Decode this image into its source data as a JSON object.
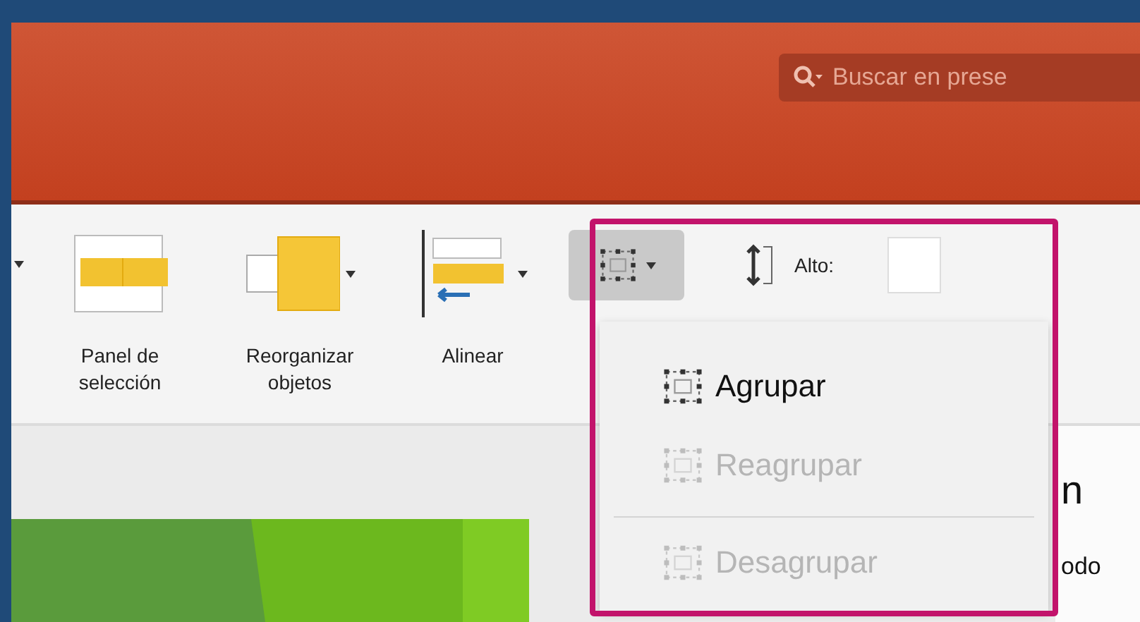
{
  "search": {
    "placeholder": "Buscar en prese"
  },
  "ribbon": {
    "items": [
      {
        "kind": "selection-pane",
        "lines": [
          "Panel de",
          "selección"
        ],
        "dropdown": false
      },
      {
        "kind": "arrange",
        "lines": [
          "Reorganizar",
          "objetos"
        ],
        "dropdown": true
      },
      {
        "kind": "align",
        "lines": [
          "Alinear"
        ],
        "dropdown": true
      }
    ],
    "group_button": {
      "pressed": true
    },
    "height": {
      "label": "Alto:"
    }
  },
  "group_menu": {
    "items": [
      {
        "label": "Agrupar",
        "disabled": false,
        "separator_before": false
      },
      {
        "label": "Reagrupar",
        "disabled": true,
        "separator_before": false
      },
      {
        "label": "Desagrupar",
        "disabled": true,
        "separator_before": true
      }
    ]
  },
  "side_pane": {
    "heading": "n",
    "text": "odo"
  }
}
